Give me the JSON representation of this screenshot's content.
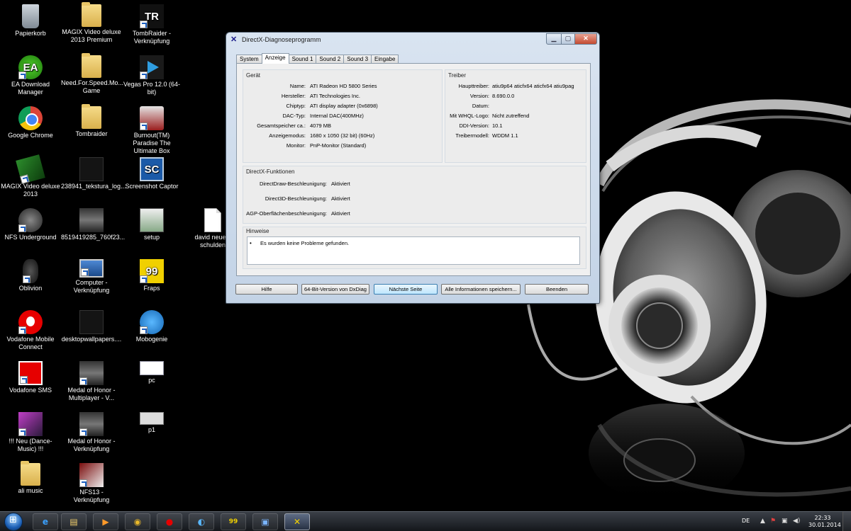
{
  "desktop": {
    "icons": [
      {
        "label": "Papierkorb",
        "icon": "recycle-bin-icon"
      },
      {
        "label": "MAGIX Video deluxe 2013 Premium",
        "icon": "folder-icon"
      },
      {
        "label": "TombRaider - Verknüpfung",
        "icon": "tombraider-icon",
        "glyph": "TR"
      },
      {
        "label": "EA Download Manager",
        "icon": "ea-icon",
        "glyph": "EA"
      },
      {
        "label": "Need.For.Speed.Mo... Game",
        "icon": "folder-icon"
      },
      {
        "label": "Vegas Pro 12.0 (64-bit)",
        "icon": "vegas-icon"
      },
      {
        "label": "Google Chrome",
        "icon": "chrome-icon"
      },
      {
        "label": "Tombraider",
        "icon": "folder-icon"
      },
      {
        "label": "Burnout(TM) Paradise The Ultimate Box",
        "icon": "burnout-icon"
      },
      {
        "label": "MAGIX Video deluxe 2013",
        "icon": "magix-icon"
      },
      {
        "label": "238941_tekstura_log...",
        "icon": "image-file-icon"
      },
      {
        "label": "Screenshot Captor",
        "icon": "screenshot-captor-icon",
        "glyph": "SC"
      },
      {
        "label": "NFS Underground",
        "icon": "nfs-underground-icon"
      },
      {
        "label": "8519419285_760f23...",
        "icon": "image-file-icon"
      },
      {
        "label": "setup",
        "icon": "setup-icon"
      },
      {
        "label": "david neue s schulden",
        "icon": "text-document-icon"
      },
      {
        "label": "Oblivion",
        "icon": "oblivion-icon"
      },
      {
        "label": "Computer - Verknüpfung",
        "icon": "computer-icon"
      },
      {
        "label": "Fraps",
        "icon": "fraps-icon",
        "glyph": "99"
      },
      {
        "label": "Vodafone Mobile Connect",
        "icon": "vodafone-icon"
      },
      {
        "label": "desktopwallpapers....",
        "icon": "image-file-icon"
      },
      {
        "label": "Mobogenie",
        "icon": "mobogenie-icon"
      },
      {
        "label": "Vodafone SMS",
        "icon": "vodafone-sms-icon"
      },
      {
        "label": "Medal of Honor - Multiplayer - V...",
        "icon": "medal-of-honor-icon"
      },
      {
        "label": "pc",
        "icon": "image-file-icon"
      },
      {
        "label": "!!! Neu (Dance-Music) !!!",
        "icon": "music-icon"
      },
      {
        "label": "Medal of Honor - Verknüpfung",
        "icon": "medal-of-honor-icon"
      },
      {
        "label": "p1",
        "icon": "image-file-icon"
      },
      {
        "label": "ali music",
        "icon": "folder-icon"
      },
      {
        "label": "NFS13 - Verknüpfung",
        "icon": "nfs13-icon"
      }
    ]
  },
  "window": {
    "title": "DirectX-Diagnoseprogramm",
    "tabs": [
      "System",
      "Anzeige",
      "Sound 1",
      "Sound 2",
      "Sound 3",
      "Eingabe"
    ],
    "active_tab": "Anzeige",
    "device": {
      "title": "Gerät",
      "rows": [
        {
          "label": "Name:",
          "value": "ATI Radeon HD 5800 Series"
        },
        {
          "label": "Hersteller:",
          "value": "ATI Technologies Inc."
        },
        {
          "label": "Chiptyp:",
          "value": "ATI display adapter (0x6898)"
        },
        {
          "label": "DAC-Typ:",
          "value": "Internal DAC(400MHz)"
        },
        {
          "label": "Gesamtspeicher ca.:",
          "value": "4079 MB"
        },
        {
          "label": "Anzeigemodus:",
          "value": "1680 x 1050 (32 bit) (60Hz)"
        },
        {
          "label": "Monitor:",
          "value": "PnP-Monitor (Standard)"
        }
      ]
    },
    "driver": {
      "title": "Treiber",
      "rows": [
        {
          "label": "Haupttreiber:",
          "value": "atiu9p64 aticfx64 aticfx64 atiu9pag"
        },
        {
          "label": "Version:",
          "value": "8.690.0.0"
        },
        {
          "label": "Datum:",
          "value": ""
        },
        {
          "label": "Mit WHQL-Logo:",
          "value": "Nicht zutreffend"
        },
        {
          "label": "DDI-Version:",
          "value": "10.1"
        },
        {
          "label": "Treibermodell:",
          "value": "WDDM 1.1"
        }
      ]
    },
    "features": {
      "title": "DirectX-Funktionen",
      "rows": [
        {
          "label": "DirectDraw-Beschleunigung:",
          "value": "Aktiviert"
        },
        {
          "label": "Direct3D-Beschleunigung:",
          "value": "Aktiviert"
        },
        {
          "label": "AGP-Oberflächenbeschleunigung:",
          "value": "Aktiviert"
        }
      ]
    },
    "notes": {
      "title": "Hinweise",
      "bullet": "•",
      "items": [
        "Es wurden keine Probleme gefunden."
      ]
    },
    "buttons": {
      "help": "Hilfe",
      "dxdiag64": "64-Bit-Version von DxDiag",
      "next": "Nächste Seite",
      "save_all": "Alle Informationen speichern...",
      "exit": "Beenden"
    }
  },
  "taskbar": {
    "apps": [
      {
        "name": "internet-explorer",
        "icon": "internet-explorer-icon",
        "glyph": "e"
      },
      {
        "name": "explorer",
        "icon": "explorer-folder-icon",
        "glyph": "▤"
      },
      {
        "name": "media",
        "icon": "media-player-icon",
        "glyph": "▶"
      },
      {
        "name": "chrome",
        "icon": "chrome-icon",
        "glyph": "◉"
      },
      {
        "name": "vodafone",
        "icon": "vodafone-icon",
        "glyph": "●"
      },
      {
        "name": "mobogenie",
        "icon": "mobogenie-icon",
        "glyph": "◐"
      },
      {
        "name": "fraps",
        "icon": "fraps-icon",
        "glyph": "99"
      },
      {
        "name": "remote",
        "icon": "remote-desktop-icon",
        "glyph": "▣"
      },
      {
        "name": "dxdiag",
        "icon": "directx-icon",
        "glyph": "✕"
      }
    ],
    "language": "DE",
    "time": "22:33",
    "date": "30.01.2014"
  }
}
